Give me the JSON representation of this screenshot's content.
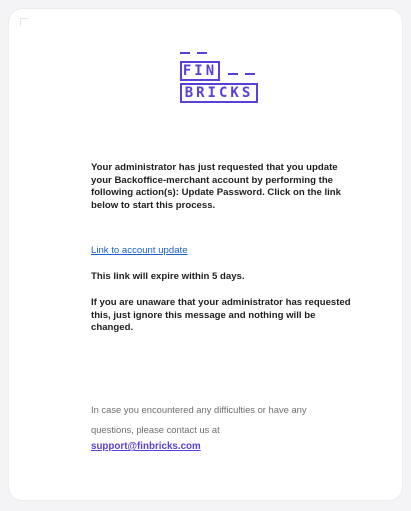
{
  "logo": {
    "word1": "FIN",
    "word2": "BRICKS",
    "color": "#5a3fd8"
  },
  "email": {
    "message": "Your administrator has just requested that you update your Backoffice-merchant account by performing the following action(s): Update Password. Click on the link below to start this process.",
    "link_text": "Link to account update",
    "expiry": "This link will expire within 5 days.",
    "unaware": "If you are unaware that your administrator has requested this, just ignore this message and nothing will be changed.",
    "help": "In case you encountered any difficulties or have any questions, please contact us at",
    "support_email": "support@finbricks.com"
  },
  "colors": {
    "link": "#1a5fd0",
    "text": "#1f1f1f",
    "muted": "#6f6f6f",
    "background": "#f4f4f6",
    "card": "#ffffff"
  }
}
